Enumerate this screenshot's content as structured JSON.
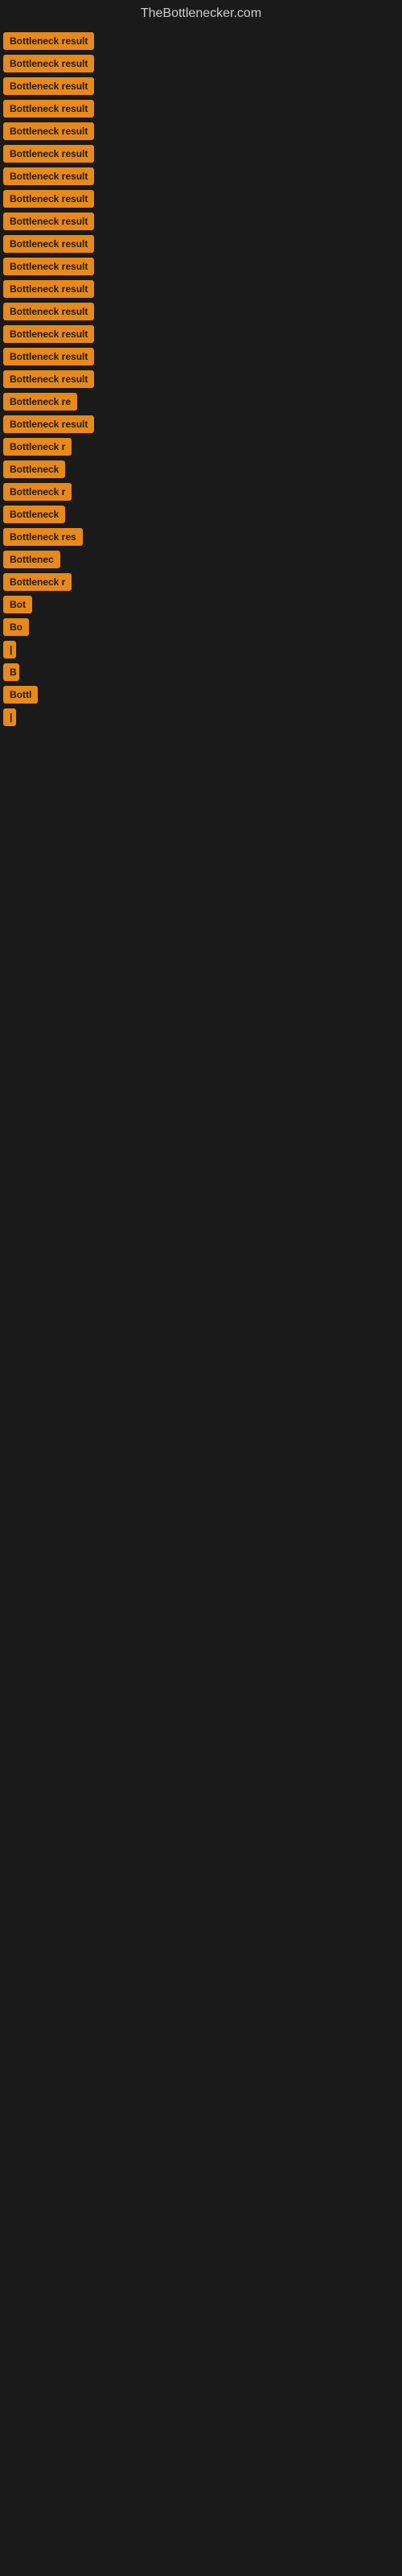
{
  "site": {
    "title": "TheBottlenecker.com"
  },
  "items": [
    {
      "id": 1,
      "label": "Bottleneck result"
    },
    {
      "id": 2,
      "label": "Bottleneck result"
    },
    {
      "id": 3,
      "label": "Bottleneck result"
    },
    {
      "id": 4,
      "label": "Bottleneck result"
    },
    {
      "id": 5,
      "label": "Bottleneck result"
    },
    {
      "id": 6,
      "label": "Bottleneck result"
    },
    {
      "id": 7,
      "label": "Bottleneck result"
    },
    {
      "id": 8,
      "label": "Bottleneck result"
    },
    {
      "id": 9,
      "label": "Bottleneck result"
    },
    {
      "id": 10,
      "label": "Bottleneck result"
    },
    {
      "id": 11,
      "label": "Bottleneck result"
    },
    {
      "id": 12,
      "label": "Bottleneck result"
    },
    {
      "id": 13,
      "label": "Bottleneck result"
    },
    {
      "id": 14,
      "label": "Bottleneck result"
    },
    {
      "id": 15,
      "label": "Bottleneck result"
    },
    {
      "id": 16,
      "label": "Bottleneck result"
    },
    {
      "id": 17,
      "label": "Bottleneck re"
    },
    {
      "id": 18,
      "label": "Bottleneck result"
    },
    {
      "id": 19,
      "label": "Bottleneck r"
    },
    {
      "id": 20,
      "label": "Bottleneck"
    },
    {
      "id": 21,
      "label": "Bottleneck r"
    },
    {
      "id": 22,
      "label": "Bottleneck"
    },
    {
      "id": 23,
      "label": "Bottleneck res"
    },
    {
      "id": 24,
      "label": "Bottlenec"
    },
    {
      "id": 25,
      "label": "Bottleneck r"
    },
    {
      "id": 26,
      "label": "Bot"
    },
    {
      "id": 27,
      "label": "Bo"
    },
    {
      "id": 28,
      "label": "|"
    },
    {
      "id": 29,
      "label": "B"
    },
    {
      "id": 30,
      "label": "Bottl"
    },
    {
      "id": 31,
      "label": "|"
    }
  ]
}
